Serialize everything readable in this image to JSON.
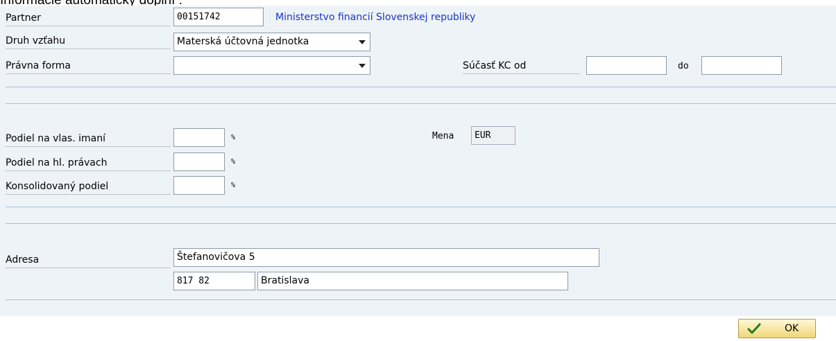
{
  "caption": "Informácie automaticky doplní :",
  "header": {
    "partner": {
      "label": "Partner",
      "value": "00151742",
      "name": "Ministerstvo financií Slovenskej republiky"
    },
    "relationship": {
      "label": "Druh vzťahu",
      "value": "Materská účtovná jednotka"
    },
    "legal_form": {
      "label": "Právna forma",
      "value": ""
    },
    "consolidation": {
      "from_label": "Súčasť KC od",
      "from_value": "",
      "to_label": "do",
      "to_value": ""
    }
  },
  "shares": {
    "equity": {
      "label": "Podiel na vlas. imaní",
      "value": "",
      "unit": "%"
    },
    "voting": {
      "label": "Podiel na hl. právach",
      "value": "",
      "unit": "%"
    },
    "consolidated": {
      "label": "Konsolidovaný podiel",
      "value": "",
      "unit": "%"
    },
    "currency": {
      "label": "Mena",
      "value": "EUR"
    }
  },
  "address": {
    "label": "Adresa",
    "street": "Štefanovičova 5",
    "postal_code": "817 82",
    "city": "Bratislava"
  },
  "footer": {
    "ok_label": "OK",
    "ok_icon": "checkmark-icon"
  }
}
